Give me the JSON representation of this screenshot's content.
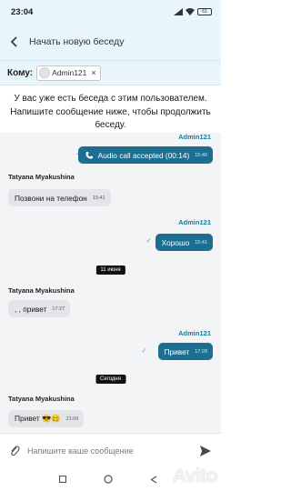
{
  "status_bar": {
    "time": "23:04",
    "battery": "61"
  },
  "header": {
    "title": "Начать новую беседу"
  },
  "recipient": {
    "label": "Кому:",
    "name": "Admin121"
  },
  "notice": "У вас уже есть беседа с этим пользователем. Напишите сообщение ниже, чтобы продолжить беседу.",
  "messages": [
    {
      "sender": "Admin121",
      "text": "Audio call accepted (00:14)",
      "time": "15:40"
    },
    {
      "sender": "Tatyana Myakushina",
      "text": "Позвони на телефон",
      "time": "15:41"
    },
    {
      "sender": "Admin121",
      "text": "Хорошо",
      "time": "15:41"
    },
    {
      "date": "11 июня"
    },
    {
      "sender": "Tatyana Myakushina",
      "text": ", , привет",
      "time": "17:27"
    },
    {
      "sender": "Admin121",
      "text": "Привет",
      "time": "17:28"
    },
    {
      "date": "Сегодня"
    },
    {
      "sender": "Tatyana Myakushina",
      "text": "Привет 😎🥴",
      "time": "21:06"
    }
  ],
  "composer": {
    "placeholder": "Напишите ваше сообщение"
  },
  "watermark": "Avito",
  "colors": {
    "accent": "#1d6f92",
    "header_bg": "#e8f5fb",
    "chat_bg": "#f3f4f6",
    "bubble_in": "#e4e5e8"
  },
  "icons": [
    "back-arrow-icon",
    "paperclip-icon",
    "send-icon",
    "phone-icon",
    "check-icon"
  ]
}
